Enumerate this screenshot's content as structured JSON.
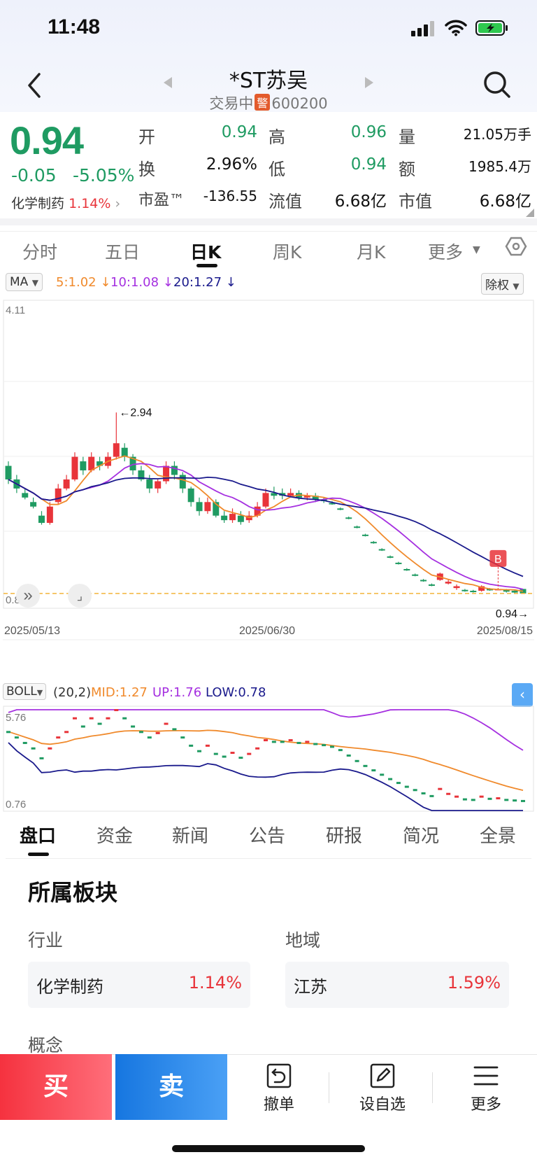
{
  "status": {
    "time": "11:48"
  },
  "header": {
    "stock_name": "*ST苏吴",
    "trade_status": "交易中",
    "warn_badge": "警",
    "stock_code": "600200"
  },
  "quote": {
    "price": "0.94",
    "change": "-0.05",
    "change_pct": "-5.05%",
    "sector_name": "化学制药",
    "sector_pct": "1.14%",
    "fields": [
      {
        "label": "开",
        "value": "0.94",
        "color": "green"
      },
      {
        "label": "高",
        "value": "0.96",
        "color": "green"
      },
      {
        "label": "量",
        "value": "21.05万手",
        "color": "black"
      },
      {
        "label": "换",
        "value": "2.96%",
        "color": "black"
      },
      {
        "label": "低",
        "value": "0.94",
        "color": "green"
      },
      {
        "label": "额",
        "value": "1985.4万",
        "color": "black"
      },
      {
        "label": "市盈™",
        "value": "-136.55",
        "color": "black"
      },
      {
        "label": "流值",
        "value": "6.68亿",
        "color": "black"
      },
      {
        "label": "市值",
        "value": "6.68亿",
        "color": "black"
      }
    ]
  },
  "kline_tabs": [
    "分时",
    "五日",
    "日K",
    "周K",
    "月K",
    "更多"
  ],
  "active_kline_tab": "日K",
  "ma_indicator": {
    "label": "MA",
    "ma5": "5:1.02",
    "ma10": "10:1.08",
    "ma20": "20:1.27",
    "colors": {
      "ma5": "#f08a2c",
      "ma10": "#a530e0",
      "ma20": "#1a1a8c"
    },
    "adjust": "除权"
  },
  "main_chart": {
    "y_max_label": "4.11",
    "y_min_label": "0.80",
    "high_annotation": "2.94",
    "last_annotation": "0.94",
    "b_marker": "B",
    "x_labels": [
      "2025/05/13",
      "2025/06/30",
      "2025/08/15"
    ]
  },
  "boll_indicator": {
    "label": "BOLL",
    "params": "(20,2)",
    "mid": "MID:1.27",
    "up": "UP:1.76",
    "low": "LOW:0.78",
    "y_max_label": "5.76",
    "y_min_label": "0.76"
  },
  "chart_data": {
    "type": "candlestick",
    "y_max": 4.11,
    "y_min": 0.8,
    "colors": {
      "up": "#e8343a",
      "down": "#1f9b62"
    },
    "candles": [
      [
        2.35,
        2.2,
        2.4,
        2.15
      ],
      [
        2.2,
        2.1,
        2.25,
        2.05
      ],
      [
        2.05,
        2.0,
        2.1,
        1.98
      ],
      [
        1.95,
        1.9,
        2.0,
        1.88
      ],
      [
        1.8,
        1.72,
        1.85,
        1.7
      ],
      [
        1.72,
        1.9,
        1.95,
        1.7
      ],
      [
        1.95,
        2.1,
        2.15,
        1.92
      ],
      [
        2.1,
        2.2,
        2.25,
        2.08
      ],
      [
        2.2,
        2.45,
        2.5,
        2.18
      ],
      [
        2.4,
        2.3,
        2.45,
        2.25
      ],
      [
        2.3,
        2.45,
        2.5,
        2.28
      ],
      [
        2.4,
        2.35,
        2.45,
        2.3
      ],
      [
        2.35,
        2.45,
        2.5,
        2.32
      ],
      [
        2.45,
        2.6,
        2.94,
        2.42
      ],
      [
        2.55,
        2.45,
        2.6,
        2.4
      ],
      [
        2.45,
        2.3,
        2.48,
        2.25
      ],
      [
        2.3,
        2.2,
        2.35,
        2.18
      ],
      [
        2.2,
        2.1,
        2.25,
        2.05
      ],
      [
        2.1,
        2.18,
        2.2,
        2.05
      ],
      [
        2.18,
        2.35,
        2.4,
        2.15
      ],
      [
        2.35,
        2.25,
        2.4,
        2.2
      ],
      [
        2.25,
        2.1,
        2.28,
        2.05
      ],
      [
        2.1,
        1.95,
        2.12,
        1.9
      ],
      [
        1.95,
        1.85,
        2.0,
        1.8
      ],
      [
        1.85,
        1.95,
        2.0,
        1.82
      ],
      [
        1.95,
        1.8,
        1.98,
        1.78
      ],
      [
        1.8,
        1.75,
        1.85,
        1.72
      ],
      [
        1.75,
        1.82,
        1.88,
        1.72
      ],
      [
        1.8,
        1.73,
        1.85,
        1.7
      ],
      [
        1.75,
        1.8,
        1.85,
        1.72
      ],
      [
        1.8,
        1.9,
        1.95,
        1.78
      ],
      [
        1.9,
        2.05,
        2.1,
        1.88
      ],
      [
        2.05,
        2.02,
        2.12,
        1.98
      ],
      [
        2.05,
        2.02,
        2.1,
        1.98
      ],
      [
        2.02,
        2.05,
        2.1,
        2.0
      ],
      [
        2.05,
        2.0,
        2.08,
        1.97
      ],
      [
        2.0,
        2.02,
        2.05,
        1.97
      ],
      [
        2.02,
        1.98,
        2.05,
        1.95
      ],
      [
        1.98,
        1.96,
        2.0,
        1.94
      ],
      [
        1.94,
        1.93,
        1.96,
        1.92
      ],
      [
        1.88,
        1.87,
        1.89,
        1.86
      ],
      [
        1.78,
        1.77,
        1.79,
        1.76
      ],
      [
        1.68,
        1.67,
        1.69,
        1.66
      ],
      [
        1.59,
        1.58,
        1.6,
        1.57
      ],
      [
        1.51,
        1.5,
        1.52,
        1.49
      ],
      [
        1.43,
        1.42,
        1.44,
        1.41
      ],
      [
        1.35,
        1.34,
        1.36,
        1.33
      ],
      [
        1.28,
        1.27,
        1.29,
        1.26
      ],
      [
        1.21,
        1.2,
        1.22,
        1.19
      ],
      [
        1.15,
        1.14,
        1.16,
        1.13
      ],
      [
        1.09,
        1.08,
        1.1,
        1.07
      ],
      [
        1.04,
        1.03,
        1.05,
        1.02
      ],
      [
        1.09,
        1.16,
        1.17,
        1.08
      ],
      [
        1.05,
        1.07,
        1.1,
        1.04
      ],
      [
        1.0,
        1.02,
        1.04,
        0.98
      ],
      [
        0.98,
        0.97,
        0.99,
        0.96
      ],
      [
        0.97,
        0.96,
        0.98,
        0.95
      ],
      [
        0.97,
        1.02,
        1.03,
        0.96
      ],
      [
        0.99,
        0.98,
        1.0,
        0.97
      ],
      [
        0.99,
        0.99,
        1.0,
        0.98
      ],
      [
        0.98,
        0.96,
        0.99,
        0.95
      ],
      [
        0.97,
        0.95,
        0.98,
        0.94
      ],
      [
        0.99,
        0.94,
        0.99,
        0.94
      ]
    ]
  },
  "sub_tabs": [
    "盘口",
    "资金",
    "新闻",
    "公告",
    "研报",
    "简况",
    "全景"
  ],
  "active_sub_tab": "盘口",
  "sectors": {
    "title": "所属板块",
    "industry_label": "行业",
    "region_label": "地域",
    "industry": {
      "name": "化学制药",
      "pct": "1.14%"
    },
    "region": {
      "name": "江苏",
      "pct": "1.59%"
    },
    "concept_label": "概念"
  },
  "bottom_bar": {
    "buy": "买",
    "sell": "卖",
    "cancel": "撤单",
    "watchlist": "设自选",
    "more": "更多"
  }
}
